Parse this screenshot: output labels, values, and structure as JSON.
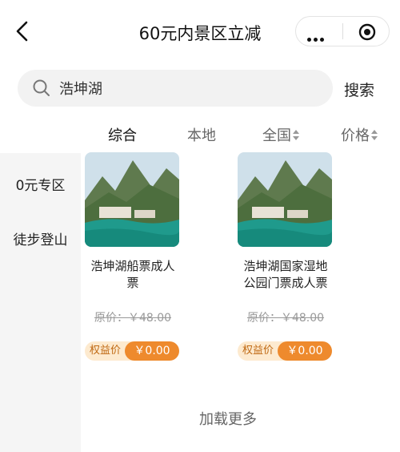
{
  "header": {
    "title": "60元内景区立减"
  },
  "search": {
    "value": "浩坤湖",
    "placeholder": "浩坤湖",
    "button_label": "搜索"
  },
  "tabs": [
    {
      "label": "综合",
      "active": true
    },
    {
      "label": "本地",
      "active": false
    },
    {
      "label": "全国",
      "active": false
    },
    {
      "label": "价格",
      "active": false
    }
  ],
  "sidebar": {
    "items": [
      {
        "label": "0元专区"
      },
      {
        "label": "徒步登山"
      }
    ]
  },
  "products": [
    {
      "name_line1": "浩坤湖船票成人",
      "name_line2": "票",
      "original_price": "原价：￥48.00",
      "benefit_label": "权益价",
      "benefit_price": "￥0.00"
    },
    {
      "name_line1": "浩坤湖国家湿地",
      "name_line2": "公园门票成人票",
      "original_price": "原价：￥48.00",
      "benefit_label": "权益价",
      "benefit_price": "￥0.00"
    }
  ],
  "load_more": "加载更多",
  "colors": {
    "accent_orange": "#ee8a2d",
    "benefit_bg": "#fdeacf",
    "sidebar_bg": "#f5f5f5"
  }
}
